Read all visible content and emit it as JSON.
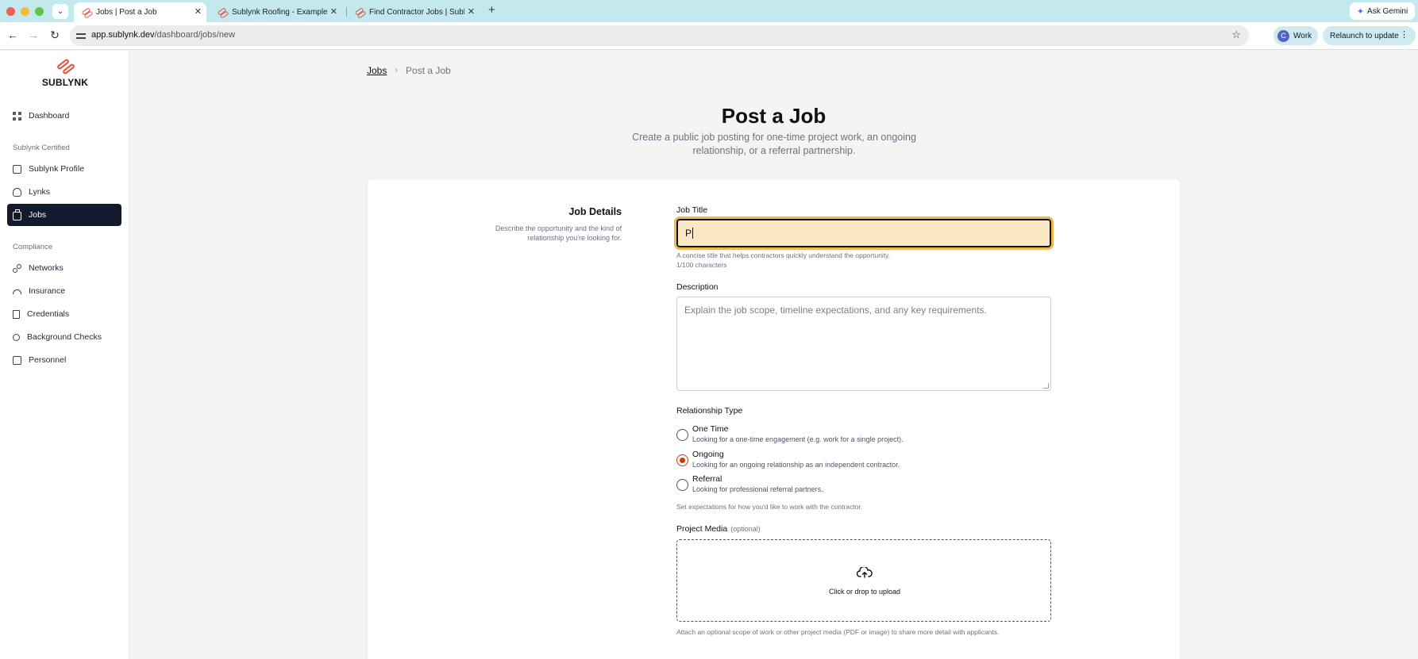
{
  "browser": {
    "tabs": [
      {
        "title": "Jobs | Post a Job",
        "active": true
      },
      {
        "title": "Sublynk Roofing - Example C",
        "active": false
      },
      {
        "title": "Find Contractor Jobs | Sublyn",
        "active": false
      }
    ],
    "url_host": "app.sublynk.dev",
    "url_path": "/dashboard/jobs/new",
    "ask_gemini": "Ask Gemini",
    "profile_initial": "C",
    "profile_name": "Work",
    "relaunch": "Relaunch to update"
  },
  "sidebar": {
    "logo_text": "SUBLYNK",
    "dashboard": "Dashboard",
    "section_certified": "Sublynk Certified",
    "certified_items": [
      "Sublynk Profile",
      "Lynks",
      "Jobs"
    ],
    "section_compliance": "Compliance",
    "compliance_items": [
      "Networks",
      "Insurance",
      "Credentials",
      "Background Checks",
      "Personnel"
    ],
    "active_item": "Jobs"
  },
  "breadcrumb": {
    "parent": "Jobs",
    "current": "Post a Job"
  },
  "page": {
    "title": "Post a Job",
    "subtitle": "Create a public job posting for one-time project work, an ongoing relationship, or a referral partnership."
  },
  "form": {
    "section_title": "Job Details",
    "section_desc": "Describe the opportunity and the kind of relationship you're looking for.",
    "job_title_label": "Job Title",
    "job_title_value": "P",
    "job_title_help": "A concise title that helps contractors quickly understand the opportunity.",
    "job_title_count": "1/100 characters",
    "description_label": "Description",
    "description_placeholder": "Explain the job scope, timeline expectations, and any key requirements.",
    "relationship_label": "Relationship Type",
    "relationship_options": [
      {
        "title": "One Time",
        "desc": "Looking for a one-time engagement (e.g. work for a single project).",
        "checked": false
      },
      {
        "title": "Ongoing",
        "desc": "Looking for an ongoing relationship as an independent contractor.",
        "checked": true
      },
      {
        "title": "Referral",
        "desc": "Looking for professional referral partners.",
        "checked": false
      }
    ],
    "relationship_help": "Set expectations for how you'd like to work with the contractor.",
    "media_label": "Project Media",
    "media_optional": "(optional)",
    "upload_text": "Click or drop to upload",
    "media_help": "Attach an optional scope of work or other project media (PDF or image) to share more detail with applicants."
  },
  "colors": {
    "accent": "#e2523d",
    "sidebar_active": "#131a2e",
    "focus_ring": "#f2b84b",
    "input_focus_bg": "#fde8c4",
    "radio_checked": "#c2410c"
  }
}
